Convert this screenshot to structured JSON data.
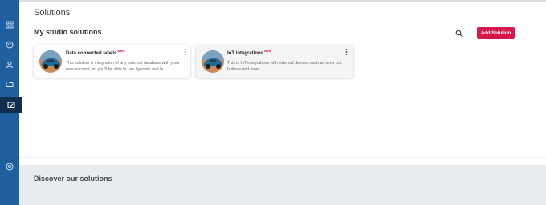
{
  "header": {
    "title": "Solutions"
  },
  "studio": {
    "section_title": "My studio solutions",
    "search_icon": "search-icon",
    "add_button_label": "Add Solution",
    "accent_color": "#d5184a"
  },
  "sidebar": {
    "background": "#1f5f9e",
    "items": [
      {
        "icon": "dashboard-icon"
      },
      {
        "icon": "palette-icon"
      },
      {
        "icon": "user-icon"
      },
      {
        "icon": "folder-icon"
      },
      {
        "icon": "solutions-icon",
        "active": true
      },
      {
        "icon": "help-icon"
      }
    ]
  },
  "cards": [
    {
      "title": "Data connected labels",
      "badge": "New",
      "description": "This solution is integration of any external database with y our user account, so you'll be able to use dynamic text la..."
    },
    {
      "title": "IoT integrations",
      "badge": "New",
      "description": "This is IoT integrations with external devices such as sens ors, buttons and more."
    }
  ],
  "discover": {
    "title": "Discover our solutions"
  }
}
